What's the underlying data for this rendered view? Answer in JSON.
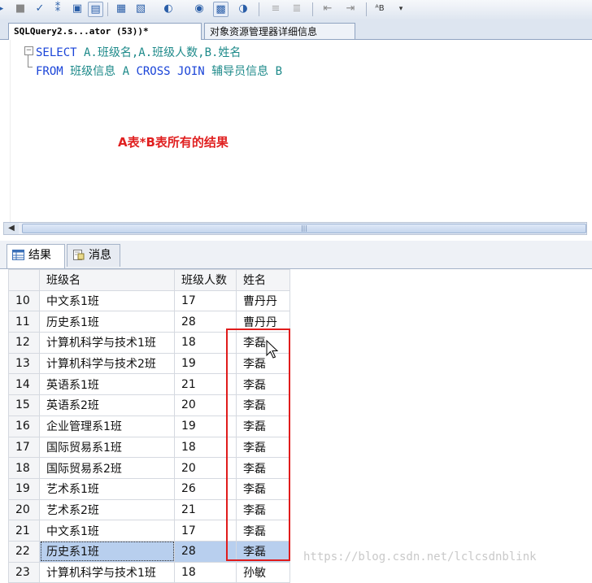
{
  "toolbar": {
    "icons": [
      "arrow-icon",
      "stop-icon",
      "check-icon",
      "parse-icon",
      "display-plan-icon",
      "results-to-text-icon",
      "results-to-grid-icon",
      "results-to-file-icon",
      "include-plan-icon",
      "client-stats-icon",
      "query-options-icon",
      "comment-icon",
      "uncomment-icon",
      "decrease-indent-icon",
      "increase-indent-icon",
      "specify-values-icon",
      "more-icon"
    ]
  },
  "tabs": [
    {
      "label": "SQLQuery2.s...ator (53))*",
      "active": true
    },
    {
      "label": "对象资源管理器详细信息",
      "active": false
    }
  ],
  "editor": {
    "line1": {
      "kw1": "SELECT",
      "rest": " A.班级名,A.班级人数,B.姓名"
    },
    "line2": {
      "kw1": "FROM",
      "t1": " 班级信息",
      "a": " A ",
      "kw2": "CROSS JOIN",
      "t2": " 辅导员信息",
      "b": " B"
    }
  },
  "annotation": "A表*B表所有的结果",
  "hscroll": {
    "grip": "|||"
  },
  "result_tabs": [
    {
      "label": "结果",
      "icon": "grid-icon",
      "active": true
    },
    {
      "label": "消息",
      "icon": "message-icon",
      "active": false
    }
  ],
  "grid": {
    "columns": [
      "",
      "班级名",
      "班级人数",
      "姓名"
    ],
    "rows": [
      [
        "10",
        "中文系1班",
        "17",
        "曹丹丹"
      ],
      [
        "11",
        "历史系1班",
        "28",
        "曹丹丹"
      ],
      [
        "12",
        "计算机科学与技术1班",
        "18",
        "李磊"
      ],
      [
        "13",
        "计算机科学与技术2班",
        "19",
        "李磊"
      ],
      [
        "14",
        "英语系1班",
        "21",
        "李磊"
      ],
      [
        "15",
        "英语系2班",
        "20",
        "李磊"
      ],
      [
        "16",
        "企业管理系1班",
        "19",
        "李磊"
      ],
      [
        "17",
        "国际贸易系1班",
        "18",
        "李磊"
      ],
      [
        "18",
        "国际贸易系2班",
        "20",
        "李磊"
      ],
      [
        "19",
        "艺术系1班",
        "26",
        "李磊"
      ],
      [
        "20",
        "艺术系2班",
        "21",
        "李磊"
      ],
      [
        "21",
        "中文系1班",
        "17",
        "李磊"
      ],
      [
        "22",
        "历史系1班",
        "28",
        "李磊"
      ]
    ],
    "partial_row": [
      "23",
      "计算机科学与技术1班",
      "18",
      "孙敏"
    ],
    "selected_row_index": 12
  },
  "watermark": "https://blog.csdn.net/lclcsdnblink"
}
